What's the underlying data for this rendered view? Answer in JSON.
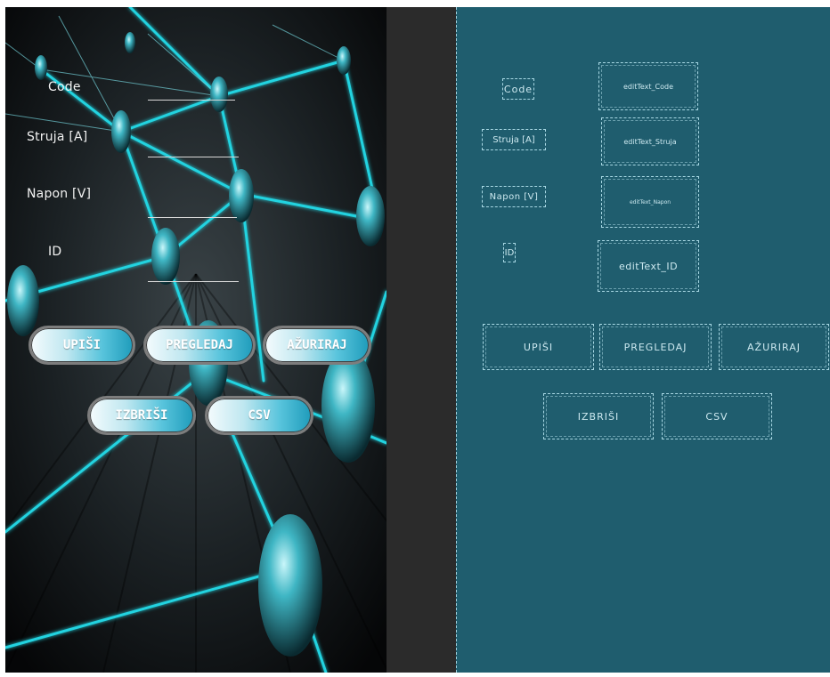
{
  "preview": {
    "labels": {
      "code": "Code",
      "struja": "Struja [A]",
      "napon": "Napon [V]",
      "id": "ID"
    },
    "buttons": {
      "upisi": "UPIŠI",
      "pregledaj": "PREGLEDAJ",
      "azuriraj": "AŽURIRAJ",
      "izbrisi": "IZBRIŠI",
      "csv": "CSV"
    }
  },
  "blueprint": {
    "labels": {
      "code": "Code",
      "struja": "Struja [A]",
      "napon": "Napon [V]",
      "id": "ID"
    },
    "edit_texts": {
      "code": "editText_Code",
      "struja": "editText_Struja",
      "napon": "editText_Napon",
      "id": "editText_ID"
    },
    "buttons": {
      "upisi": "UPIŠI",
      "pregledaj": "PREGLEDAJ",
      "azuriraj": "AŽURIRAJ",
      "izbrisi": "IZBRIŠI",
      "csv": "CSV"
    }
  },
  "colors": {
    "blueprint_bg": "#1f5d6e",
    "gutter_bg": "#2b2b2b",
    "accent_cyan": "#22d3e0"
  }
}
